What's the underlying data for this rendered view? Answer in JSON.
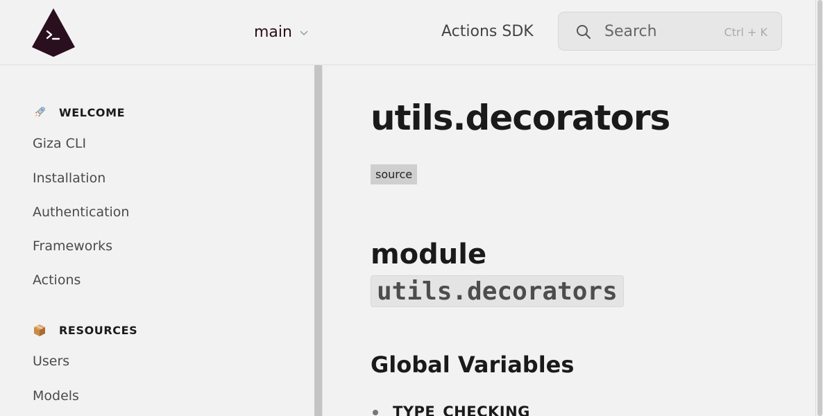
{
  "header": {
    "logo_icon": "giza-terminal-logo-icon",
    "version": "main",
    "nav_link": "Actions SDK",
    "search": {
      "label": "Search",
      "shortcut": "Ctrl + K",
      "icon": "search-icon"
    }
  },
  "sidebar": {
    "sections": [
      {
        "title": "WELCOME",
        "icon": "rocket-icon",
        "items": [
          "Giza CLI",
          "Installation",
          "Authentication",
          "Frameworks",
          "Actions"
        ]
      },
      {
        "title": "RESOURCES",
        "icon": "package-icon",
        "items": [
          "Users",
          "Models"
        ]
      }
    ]
  },
  "main": {
    "title": "utils.decorators",
    "source_label": "source",
    "module_heading": "module",
    "module_code": "utils.decorators",
    "global_vars_heading": "Global Variables",
    "global_vars": [
      "TYPE_CHECKING"
    ]
  },
  "colors": {
    "brand": "#2a0f1e",
    "background": "#f2f2f2",
    "text": "#1a1a1a"
  }
}
